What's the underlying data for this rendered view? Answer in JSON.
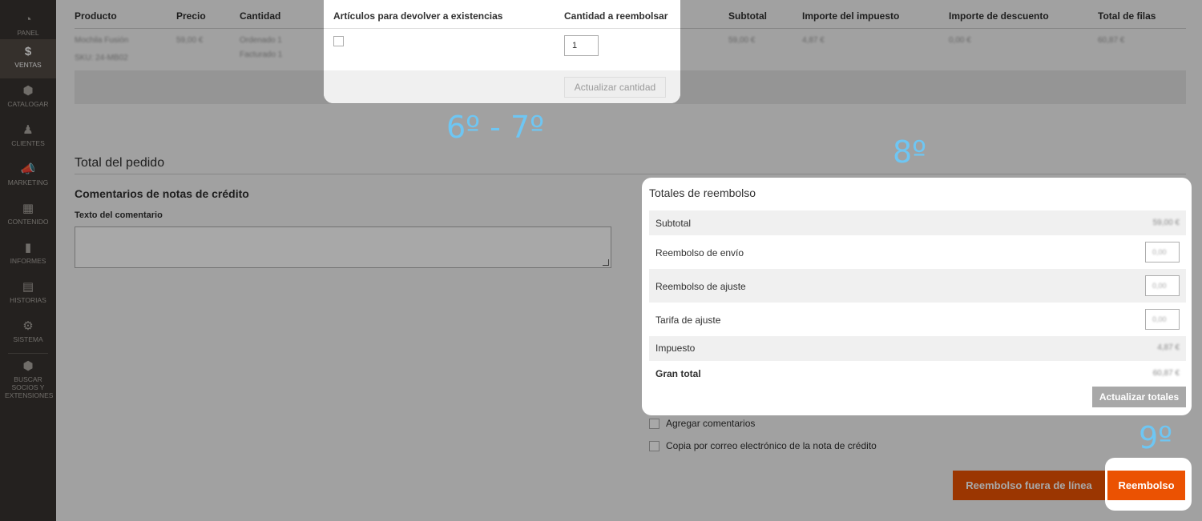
{
  "sidebar": {
    "items": [
      {
        "label": "PANEL",
        "icon": "dashboard-icon",
        "glyph": "◔"
      },
      {
        "label": "VENTAS",
        "icon": "dollar-icon",
        "glyph": "$"
      },
      {
        "label": "CATALOGAR",
        "icon": "cube-icon",
        "glyph": "⬢"
      },
      {
        "label": "CLIENTES",
        "icon": "person-icon",
        "glyph": "♟"
      },
      {
        "label": "MARKETING",
        "icon": "megaphone-icon",
        "glyph": "📣"
      },
      {
        "label": "CONTENIDO",
        "icon": "layout-icon",
        "glyph": "▦"
      },
      {
        "label": "INFORMES",
        "icon": "bar-chart-icon",
        "glyph": "▮"
      },
      {
        "label": "HISTORIAS",
        "icon": "store-icon",
        "glyph": "▤"
      },
      {
        "label": "SISTEMA",
        "icon": "gear-icon",
        "glyph": "⚙"
      },
      {
        "label": "BUSCAR SOCIOS Y EXTENSIONES",
        "icon": "partners-icon",
        "glyph": "⬢"
      }
    ]
  },
  "items_table": {
    "headers": {
      "product": "Producto",
      "price": "Precio",
      "qty": "Cantidad",
      "subtotal": "Subtotal",
      "tax": "Importe del impuesto",
      "discount": "Importe de descuento",
      "row_total": "Total de filas"
    },
    "row": {
      "product_name": "Mochila Fusión",
      "sku": "SKU: 24-MB02",
      "price": "59,00 €",
      "qty_ordered": "Ordenado 1",
      "qty_invoiced": "Facturado 1",
      "subtotal": "59,00 €",
      "tax": "4,87 €",
      "discount": "0,00 €",
      "row_total": "60,87 €"
    }
  },
  "stock_panel": {
    "return_to_stock_header": "Artículos para devolver a existencias",
    "qty_to_refund_header": "Cantidad a reembolsar",
    "qty_value": "1",
    "update_qty_button": "Actualizar cantidad"
  },
  "order_total": {
    "title": "Total del pedido",
    "comments_title": "Comentarios de notas de crédito",
    "comment_label": "Texto del comentario"
  },
  "refund_totals": {
    "title": "Totales de reembolso",
    "subtotal_label": "Subtotal",
    "subtotal_value": "59,00 €",
    "shipping_label": "Reembolso de envío",
    "shipping_value": "0,00",
    "adjustment_refund_label": "Reembolso de ajuste",
    "adjustment_refund_value": "0,00",
    "adjustment_fee_label": "Tarifa de ajuste",
    "adjustment_fee_value": "0,00",
    "tax_label": "Impuesto",
    "tax_value": "4,87 €",
    "grand_total_label": "Gran total",
    "grand_total_value": "60,87 €",
    "update_totals_button": "Actualizar totales"
  },
  "options": {
    "append_comments": "Agregar comentarios",
    "email_copy": "Copia por correo electrónico de la nota de crédito"
  },
  "actions": {
    "refund_offline": "Reembolso fuera de línea",
    "refund": "Reembolso"
  },
  "steps": {
    "step_6_7": "6º - 7º",
    "step_8": "8º",
    "step_9": "9º"
  },
  "colors": {
    "sidebar_bg": "#373330",
    "sidebar_active": "#514943",
    "accent": "#eb5202",
    "step_label": "#6ec6f3"
  }
}
